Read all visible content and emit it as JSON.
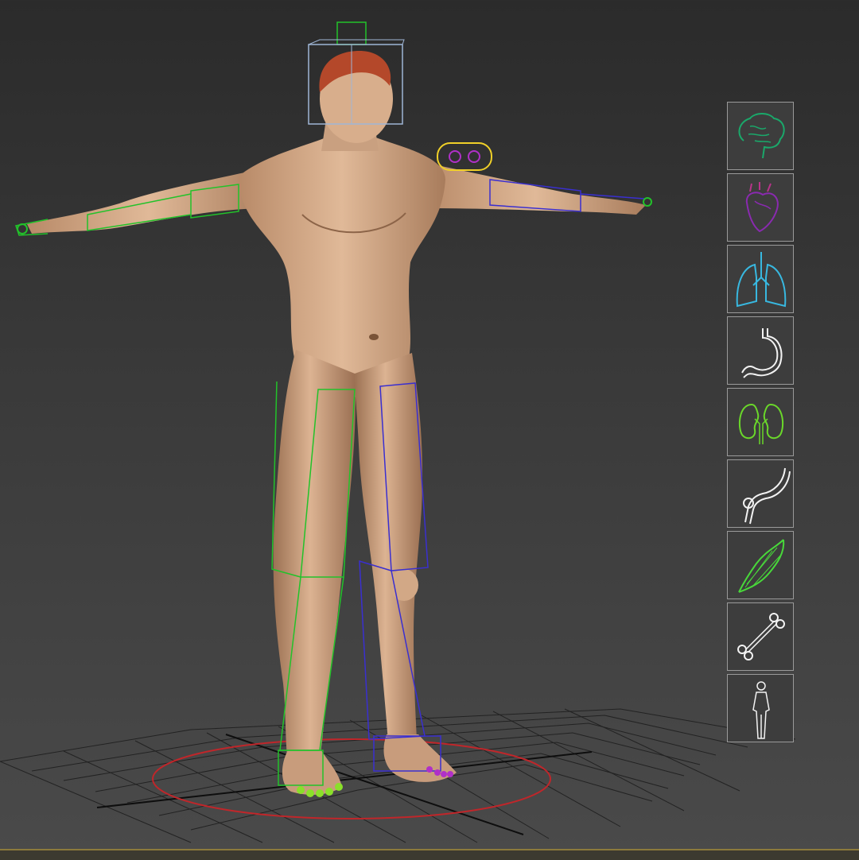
{
  "viewport": {
    "model": "male-anatomy-base-mesh",
    "rig": "biped-rig",
    "colors": {
      "background_top": "#2b2b2b",
      "background_bottom": "#4a4a4a",
      "skin": "#d9b08f",
      "hair": "#b4482a",
      "rig_left": "#22c22a",
      "rig_right": "#3a2fd0",
      "rig_head": "#9fb6d6",
      "rig_hand_marker": "#f0d028",
      "grid": "#1a1a1a",
      "ground_circle": "#c0262a",
      "toe_markers_left": "#8ae02a",
      "toe_markers_right": "#b030c8"
    }
  },
  "layer_panel": {
    "items": [
      {
        "name": "nervous-system",
        "icon": "brain-icon",
        "color": "#1aa86a"
      },
      {
        "name": "cardiovascular",
        "icon": "heart-icon",
        "color": "#8a2ab0"
      },
      {
        "name": "respiratory",
        "icon": "lungs-icon",
        "color": "#38b8e0"
      },
      {
        "name": "digestive",
        "icon": "stomach-icon",
        "color": "#f2f2f2"
      },
      {
        "name": "urinary",
        "icon": "kidneys-icon",
        "color": "#6ad82a"
      },
      {
        "name": "skeletal-joints",
        "icon": "joint-icon",
        "color": "#f2f2f2"
      },
      {
        "name": "muscular",
        "icon": "muscle-icon",
        "color": "#48d83a"
      },
      {
        "name": "skeletal",
        "icon": "bone-icon",
        "color": "#f2f2f2"
      },
      {
        "name": "full-body",
        "icon": "body-silhouette-icon",
        "color": "#f2f2f2"
      }
    ]
  }
}
